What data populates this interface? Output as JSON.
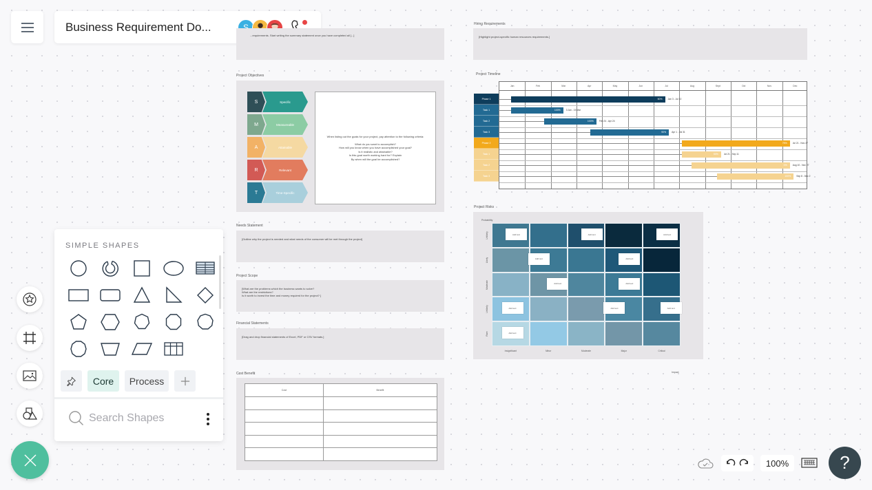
{
  "header": {
    "menu_icon": "hamburger-icon",
    "title": "Business Requirement Do...",
    "collaborators": [
      {
        "initial": "S",
        "color": "#3ab0e2"
      },
      {
        "initial": "",
        "color": "#f5b942"
      },
      {
        "initial": "",
        "color": "#e64444"
      }
    ],
    "call_icon": "phone-icon"
  },
  "document": {
    "summary": {
      "text": "...requirements. Start writing the summary statement once you have completed all [...]"
    },
    "objectives": {
      "label": "Project Objectives",
      "smart": [
        {
          "letter": "S",
          "word": "Specific",
          "letter_color": "#2f4f57",
          "word_color": "#2a9a8e"
        },
        {
          "letter": "M",
          "word": "Measureable",
          "letter_color": "#7ea88e",
          "word_color": "#8ccca4"
        },
        {
          "letter": "A",
          "word": "Attainable",
          "letter_color": "#f2b266",
          "word_color": "#f5d9a2"
        },
        {
          "letter": "R",
          "word": "Relevant",
          "letter_color": "#d25a55",
          "word_color": "#e27c5e"
        },
        {
          "letter": "T",
          "word": "Time-Specific",
          "letter_color": "#2b7a94",
          "word_color": "#a9cfdc"
        }
      ],
      "criteria_text": "When listing out the goals for your project, pay attention to the following criteria:\n\nWhat do you want to accomplish?\nHow will you know when you have accomplished your goal?\nIs it realistic and attainable?\nIs this goal worth working hard for? Explain\nBy when will the goal be accomplished?"
    },
    "needs": {
      "label": "Needs Statement",
      "text": "[Outline why the project is needed and what needs of the consumer will be met through the project]"
    },
    "scope": {
      "label": "Project Scope",
      "text": "[What are the problems which the business wants to solve?\nWhat are the restrictions?\nIs it worth to invest the time and money required for the project? ]"
    },
    "financial": {
      "label": "Financial Statements",
      "text": "[Drag and drop financial statements of Excel, PDF or CSV formats.]"
    },
    "cost_benefit": {
      "label": "Cost Benefit",
      "headers": [
        "Cost",
        "Benefit"
      ],
      "rows": [
        [
          "",
          ""
        ],
        [
          "",
          ""
        ],
        [
          "",
          ""
        ],
        [
          "",
          ""
        ],
        [
          "",
          ""
        ]
      ]
    },
    "hiring": {
      "label": "Hiring Requirements",
      "text": "[Highlight project-specific human resources requirements.]"
    },
    "timeline": {
      "label": "Project Timeline",
      "months": [
        "Jan",
        "Feb",
        "Mar",
        "Apr",
        "May",
        "Jun",
        "Jul",
        "Aug",
        "Sept",
        "Oct",
        "Nov",
        "Dec"
      ],
      "tasks": [
        {
          "name": "Phase 1",
          "color": "#0e3d5c",
          "bar_color": "#0e3d5c",
          "start": 0.0,
          "end": 6.05,
          "progress": "50%",
          "dates": "Jan 3 - Jul 10"
        },
        {
          "name": "Task 1",
          "color": "#226a93",
          "bar_color": "#226a93",
          "start": 0.0,
          "end": 2.05,
          "progress": "100%",
          "dates": "3 Jan - 15 Mar"
        },
        {
          "name": "Task 2",
          "color": "#226a93",
          "bar_color": "#226a93",
          "start": 1.3,
          "end": 3.35,
          "progress": "100%",
          "dates": "Feb 24 - Apr 24"
        },
        {
          "name": "Task 3",
          "color": "#226a93",
          "bar_color": "#226a93",
          "start": 3.1,
          "end": 6.2,
          "progress": "90%",
          "dates": "Apr 1 - Jul 31"
        },
        {
          "name": "Phase 2",
          "color": "#f2a91c",
          "bar_color": "#f2a91c",
          "start": 6.7,
          "end": 10.95,
          "progress": "75%",
          "dates": "Jul 21 - Nov 27"
        },
        {
          "name": "Task 1",
          "color": "#f5d390",
          "bar_color": "#f5d390",
          "start": 6.7,
          "end": 8.25,
          "progress": "50%",
          "dates": "Jul 21 - Sep 11"
        },
        {
          "name": "Task 2",
          "color": "#f5d390",
          "bar_color": "#f5d390",
          "start": 7.1,
          "end": 10.95,
          "progress": "0%",
          "dates": "Aug 10 - Nov 27"
        },
        {
          "name": "Task 3",
          "color": "#f5d390",
          "bar_color": "#f5d390",
          "start": 8.1,
          "end": 11.1,
          "progress": "100%",
          "dates": "Sep 8 - Dec 2"
        }
      ]
    },
    "risks": {
      "label": "Project Risks",
      "y_title": "Probability",
      "x_title": "Impact",
      "y_labels": [
        "Unlikely",
        "Likely",
        "Moderate",
        "Unlikely",
        "Rare"
      ],
      "x_labels": [
        "Insignificant",
        "Minor",
        "Moderate",
        "Major",
        "Critical"
      ],
      "cell_colors": [
        [
          "#3f7891",
          "#336f8c",
          "#1f4f6c",
          "#0a2a3d",
          "#0b2e44"
        ],
        [
          "#6b95a6",
          "#3d7a95",
          "#3a7792",
          "#1f5878",
          "#07263a"
        ],
        [
          "#88b2c6",
          "#6e95a6",
          "#4f869e",
          "#3c7a96",
          "#1d5775"
        ],
        [
          "#8dc3e0",
          "#8ab1c4",
          "#7a9bad",
          "#4a87a2",
          "#366f8c"
        ],
        [
          "#b6d8e4",
          "#93c9e5",
          "#8ab4c6",
          "#7396a8",
          "#56889f"
        ]
      ],
      "notes": [
        {
          "row": 0,
          "col": 0,
          "text": "Add text"
        },
        {
          "row": 0,
          "col": 2,
          "text": "Add text"
        },
        {
          "row": 0,
          "col": 4,
          "text": "Add text"
        },
        {
          "row": 1,
          "col": 0.6,
          "text": "Add text"
        },
        {
          "row": 1,
          "col": 3,
          "text": "Add text"
        },
        {
          "row": 2,
          "col": 1.1,
          "text": "Add text"
        },
        {
          "row": 2,
          "col": 3,
          "text": "Add text"
        },
        {
          "row": 3,
          "col": -0.1,
          "text": "Add text"
        },
        {
          "row": 3,
          "col": 2.6,
          "text": "Add text"
        },
        {
          "row": 3,
          "col": 4.1,
          "text": "Add text"
        },
        {
          "row": 4,
          "col": -0.1,
          "text": "Add text"
        }
      ]
    }
  },
  "shapes_panel": {
    "heading": "SIMPLE SHAPES",
    "shapes": [
      "circle",
      "arc",
      "square",
      "ellipse",
      "table",
      "rectangle",
      "rounded-rectangle",
      "triangle",
      "right-triangle",
      "diamond",
      "pentagon",
      "hexagon",
      "heptagon",
      "octagon",
      "nonagon",
      "decagon",
      "trapezoid",
      "parallelogram",
      "grid"
    ],
    "tabs": [
      {
        "label": "",
        "icon": "pin-icon",
        "active": false
      },
      {
        "label": "Core",
        "active": true
      },
      {
        "label": "Process",
        "active": false
      },
      {
        "label": "+",
        "icon": "plus-icon",
        "active": false
      }
    ],
    "search_placeholder": "Search Shapes"
  },
  "left_tools": [
    "sticker-icon",
    "frame-icon",
    "image-icon",
    "shapes-icon"
  ],
  "footer": {
    "zoom": "100%",
    "help": "?"
  }
}
